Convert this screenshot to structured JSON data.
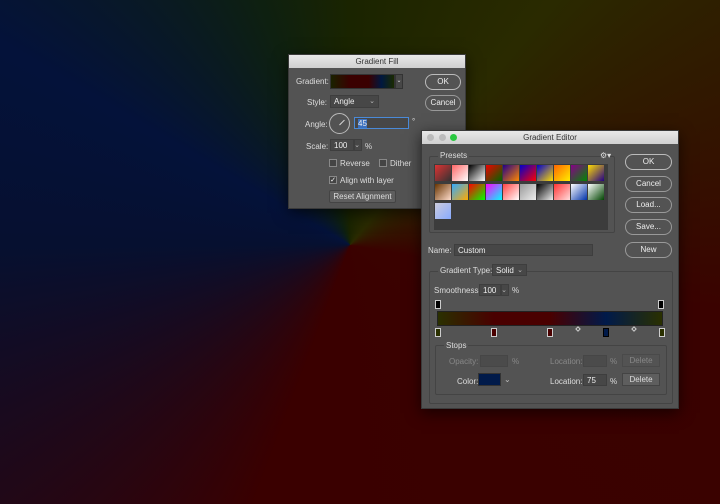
{
  "gradient_fill": {
    "title": "Gradient Fill",
    "gradient_label": "Gradient:",
    "style_label": "Style:",
    "style_value": "Angle",
    "angle_label": "Angle:",
    "angle_value": "45",
    "degree_symbol": "°",
    "scale_label": "Scale:",
    "scale_value": "100",
    "percent": "%",
    "reverse_label": "Reverse",
    "reverse_checked": false,
    "dither_label": "Dither",
    "dither_checked": false,
    "align_label": "Align with layer",
    "align_checked": true,
    "reset_label": "Reset Alignment",
    "ok": "OK",
    "cancel": "Cancel"
  },
  "gradient_editor": {
    "title": "Gradient Editor",
    "presets_label": "Presets",
    "gear_icon": "gear-icon",
    "ok": "OK",
    "cancel": "Cancel",
    "load": "Load...",
    "save": "Save...",
    "name_label": "Name:",
    "name_value": "Custom",
    "new": "New",
    "type_label": "Gradient Type:",
    "type_value": "Solid",
    "smoothness_label": "Smoothness:",
    "smoothness_value": "100",
    "percent": "%",
    "color_stops": [
      {
        "color": "#2a3000",
        "location": 0
      },
      {
        "color": "#4a0000",
        "location": 25
      },
      {
        "color": "#4a0000",
        "location": 50
      },
      {
        "color": "#001a4a",
        "location": 75
      },
      {
        "color": "#2a3000",
        "location": 100
      }
    ],
    "selected_stop": 75,
    "stops": {
      "title": "Stops",
      "opacity_label": "Opacity:",
      "location_label": "Location:",
      "delete": "Delete",
      "color_label": "Color:",
      "color_value": "#001a4a",
      "location_value": "75",
      "percent": "%"
    },
    "presets": [
      "#d33,#333",
      "#f66,#fff",
      "#000,#fff",
      "#e00,#060",
      "#208,#f80",
      "#00c,#f00",
      "#00c,#fd0",
      "#f60,#fe0",
      "#808,#080",
      "#fd0,#208",
      "#630,#fdc",
      "#3af,#fa0",
      "#f00,#0f0",
      "#f0f,#0ff",
      "#f44,#fff",
      "#999,#eee",
      "#000,#eee",
      "#f33,#fdd",
      "#fff,#03a",
      "#fff,#040",
      "#ccd,#8af"
    ]
  }
}
